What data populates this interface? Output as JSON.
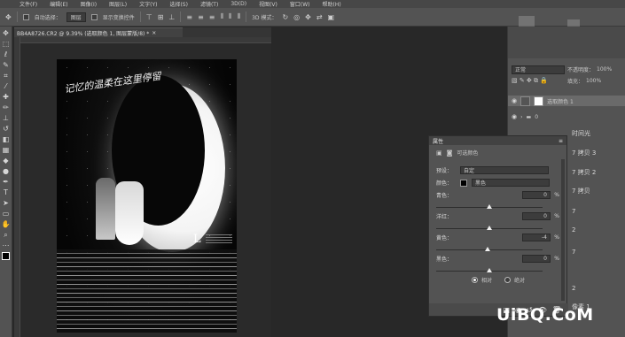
{
  "menubar": {
    "items": [
      "文件(F)",
      "编辑(E)",
      "图像(I)",
      "图层(L)",
      "文字(Y)",
      "选择(S)",
      "滤镜(T)",
      "3D(D)",
      "视图(V)",
      "窗口(W)",
      "帮助(H)"
    ]
  },
  "options": {
    "auto_select_label": "自动选择：",
    "auto_select_value": "图层",
    "show_transform_label": "显示变换控件",
    "mode_3d": "3D 模式："
  },
  "document": {
    "tab_title": "BB4A8726.CR2 @ 9.39% (选取颜色 1, 图层蒙版/8) *",
    "art_title": "记忆的温柔在这里停留",
    "art_logo": "L"
  },
  "tools": [
    "move-icon",
    "marquee-icon",
    "lasso-icon",
    "quick-select-icon",
    "crop-icon",
    "eyedropper-icon",
    "healing-icon",
    "brush-icon",
    "stamp-icon",
    "history-brush-icon",
    "eraser-icon",
    "gradient-icon",
    "blur-icon",
    "dodge-icon",
    "pen-icon",
    "type-icon",
    "path-select-icon",
    "shape-icon",
    "hand-icon",
    "zoom-icon"
  ],
  "layers": {
    "blend_mode": "正常",
    "opacity_label": "不透明度：",
    "opacity_value": "100%",
    "fill_label": "填充：",
    "fill_value": "100%",
    "active_layer_name": "选取颜色 1",
    "group_name": "0",
    "right_labels": [
      "时间光",
      "7 拷贝 3",
      "7 拷贝 2",
      "7 拷贝",
      "7",
      "2",
      "7",
      "2",
      "像素 1"
    ]
  },
  "properties": {
    "title": "属性",
    "adjustment_name": "可选颜色",
    "preset_label": "预设：",
    "preset_value": "自定",
    "color_label": "颜色：",
    "color_value": "黑色",
    "sliders": [
      {
        "label": "青色：",
        "value": "0",
        "unit": "%",
        "position": 0.5
      },
      {
        "label": "洋红：",
        "value": "0",
        "unit": "%",
        "position": 0.5
      },
      {
        "label": "黄色：",
        "value": "-4",
        "unit": "%",
        "position": 0.48
      },
      {
        "label": "黑色：",
        "value": "0",
        "unit": "%",
        "position": 0.5
      }
    ],
    "method_relative": "相对",
    "method_absolute": "绝对",
    "method_selected": "相对"
  },
  "watermark": "UiBQ.CoM",
  "colors": {
    "panel": "#535353",
    "background": "#282828",
    "accent": "#ffffff"
  }
}
